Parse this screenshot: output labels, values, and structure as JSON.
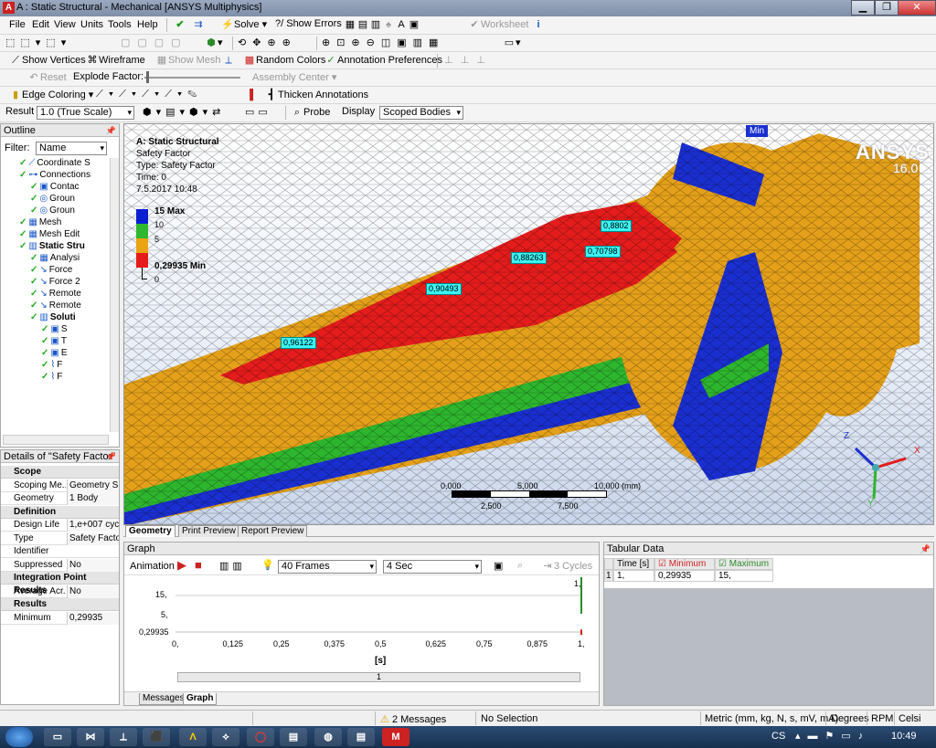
{
  "window": {
    "title": "A : Static Structural - Mechanical [ANSYS Multiphysics]",
    "app_icon": "A",
    "min_icon": "▁",
    "restore_icon": "❐",
    "close_icon": "✕"
  },
  "menu": {
    "items": [
      "File",
      "Edit",
      "View",
      "Units",
      "Tools",
      "Help"
    ],
    "solve": "Solve",
    "show_errors": "?/ Show Errors",
    "worksheet": "Worksheet"
  },
  "toolbar3": {
    "show_vertices": "Show Vertices",
    "wireframe": "Wireframe",
    "show_mesh": "Show Mesh",
    "random_colors": "Random Colors",
    "annotation_prefs": "Annotation Preferences"
  },
  "toolbar4": {
    "reset": "Reset",
    "explode_factor": "Explode Factor:",
    "assembly_center": "Assembly Center"
  },
  "toolbar5": {
    "edge_coloring": "Edge Coloring",
    "thicken_annotations": "Thicken Annotations"
  },
  "toolbar6": {
    "result_label": "Result",
    "result_value": "1.0 (True Scale)",
    "probe": "Probe",
    "display_label": "Display",
    "display_value": "Scoped Bodies"
  },
  "outline": {
    "title": "Outline",
    "filter_label": "Filter:",
    "filter_value": "Name",
    "items": [
      {
        "label": "Coordinate S",
        "indent": 0
      },
      {
        "label": "Connections",
        "indent": 0
      },
      {
        "label": "Contac",
        "indent": 1
      },
      {
        "label": "Groun",
        "indent": 1
      },
      {
        "label": "Groun",
        "indent": 1
      },
      {
        "label": "Mesh",
        "indent": 0
      },
      {
        "label": "Mesh Edit",
        "indent": 0
      },
      {
        "label": "Static Stru",
        "indent": 0
      },
      {
        "label": "Analysi",
        "indent": 1
      },
      {
        "label": "Force",
        "indent": 1
      },
      {
        "label": "Force 2",
        "indent": 1
      },
      {
        "label": "Remote",
        "indent": 1
      },
      {
        "label": "Remote",
        "indent": 1
      },
      {
        "label": "Soluti",
        "indent": 1
      },
      {
        "label": "S",
        "indent": 2
      },
      {
        "label": "T",
        "indent": 2
      },
      {
        "label": "E",
        "indent": 2
      },
      {
        "label": "F",
        "indent": 2
      },
      {
        "label": "F",
        "indent": 2
      }
    ]
  },
  "details": {
    "title": "Details of \"Safety Factor\"",
    "groups": [
      {
        "name": "Scope",
        "rows": [
          [
            "Scoping Me...",
            "Geometry S..."
          ],
          [
            "Geometry",
            "1 Body"
          ]
        ]
      },
      {
        "name": "Definition",
        "rows": [
          [
            "Design Life",
            "1,e+007 cyc..."
          ],
          [
            "Type",
            "Safety Factor"
          ],
          [
            "Identifier",
            ""
          ],
          [
            "Suppressed",
            "No"
          ]
        ]
      },
      {
        "name": "Integration Point Results",
        "rows": [
          [
            "Average Acr...",
            "No"
          ]
        ]
      },
      {
        "name": "Results",
        "rows": [
          [
            "Minimum",
            "0,29935"
          ]
        ]
      }
    ]
  },
  "viewport": {
    "header": [
      "A: Static Structural",
      "Safety Factor",
      "Type: Safety Factor",
      "Time: 0",
      "7.5.2017 10:48"
    ],
    "legend": {
      "labels": [
        "15 Max",
        "10",
        "5",
        "",
        "0,29935 Min",
        "0"
      ],
      "colors": [
        "#0a1fd1",
        "#2fb82f",
        "#e9a314",
        "#e61b1b"
      ]
    },
    "brand": "ANSYS",
    "version": "16.0",
    "probes": [
      "0,8802",
      "0,70798",
      "0,88263",
      "0,90493",
      "0,96122"
    ],
    "min_tag": "Min",
    "scale": {
      "top": [
        "0,000",
        "5,000",
        "10,000 (mm)"
      ],
      "bottom": [
        "2,500",
        "7,500"
      ]
    },
    "axes": {
      "x": "X",
      "y": "Y",
      "z": "Z"
    }
  },
  "view_tabs": [
    "Geometry",
    "Print Preview",
    "Report Preview"
  ],
  "graph": {
    "title": "Graph",
    "animation": "Animation",
    "frames": "40 Frames",
    "duration": "4 Sec",
    "cycles": "3 Cycles",
    "y_ticks": [
      "15,",
      "5,",
      "0,29935"
    ],
    "x_ticks": [
      "0,",
      "0,125",
      "0,25",
      "0,375",
      "0,5",
      "0,625",
      "0,75",
      "0,875",
      "1,"
    ],
    "top_tick": "1,",
    "x_unit": "[s]",
    "timeline_label": "1",
    "tabs": [
      "Messages",
      "Graph"
    ]
  },
  "chart_data": {
    "type": "line",
    "x": [
      0,
      1
    ],
    "series": [
      {
        "name": "Minimum",
        "values": [
          0.29935,
          0.29935
        ]
      },
      {
        "name": "Maximum",
        "values": [
          15,
          15
        ]
      }
    ],
    "xlabel": "[s]",
    "ylabel": "",
    "ylim": [
      0,
      15
    ]
  },
  "tabular": {
    "title": "Tabular Data",
    "headers": [
      "Time [s]",
      "Minimum",
      "Maximum"
    ],
    "rows": [
      [
        "1",
        "1,",
        "0,29935",
        "15,"
      ]
    ]
  },
  "status": {
    "messages": "2 Messages",
    "selection": "No Selection",
    "units": "Metric (mm, kg, N, s, mV, mA)",
    "degrees": "Degrees",
    "rpm": "RPM",
    "temp": "Celsi"
  },
  "taskbar": {
    "lang": "CS",
    "clock": "10:49"
  }
}
